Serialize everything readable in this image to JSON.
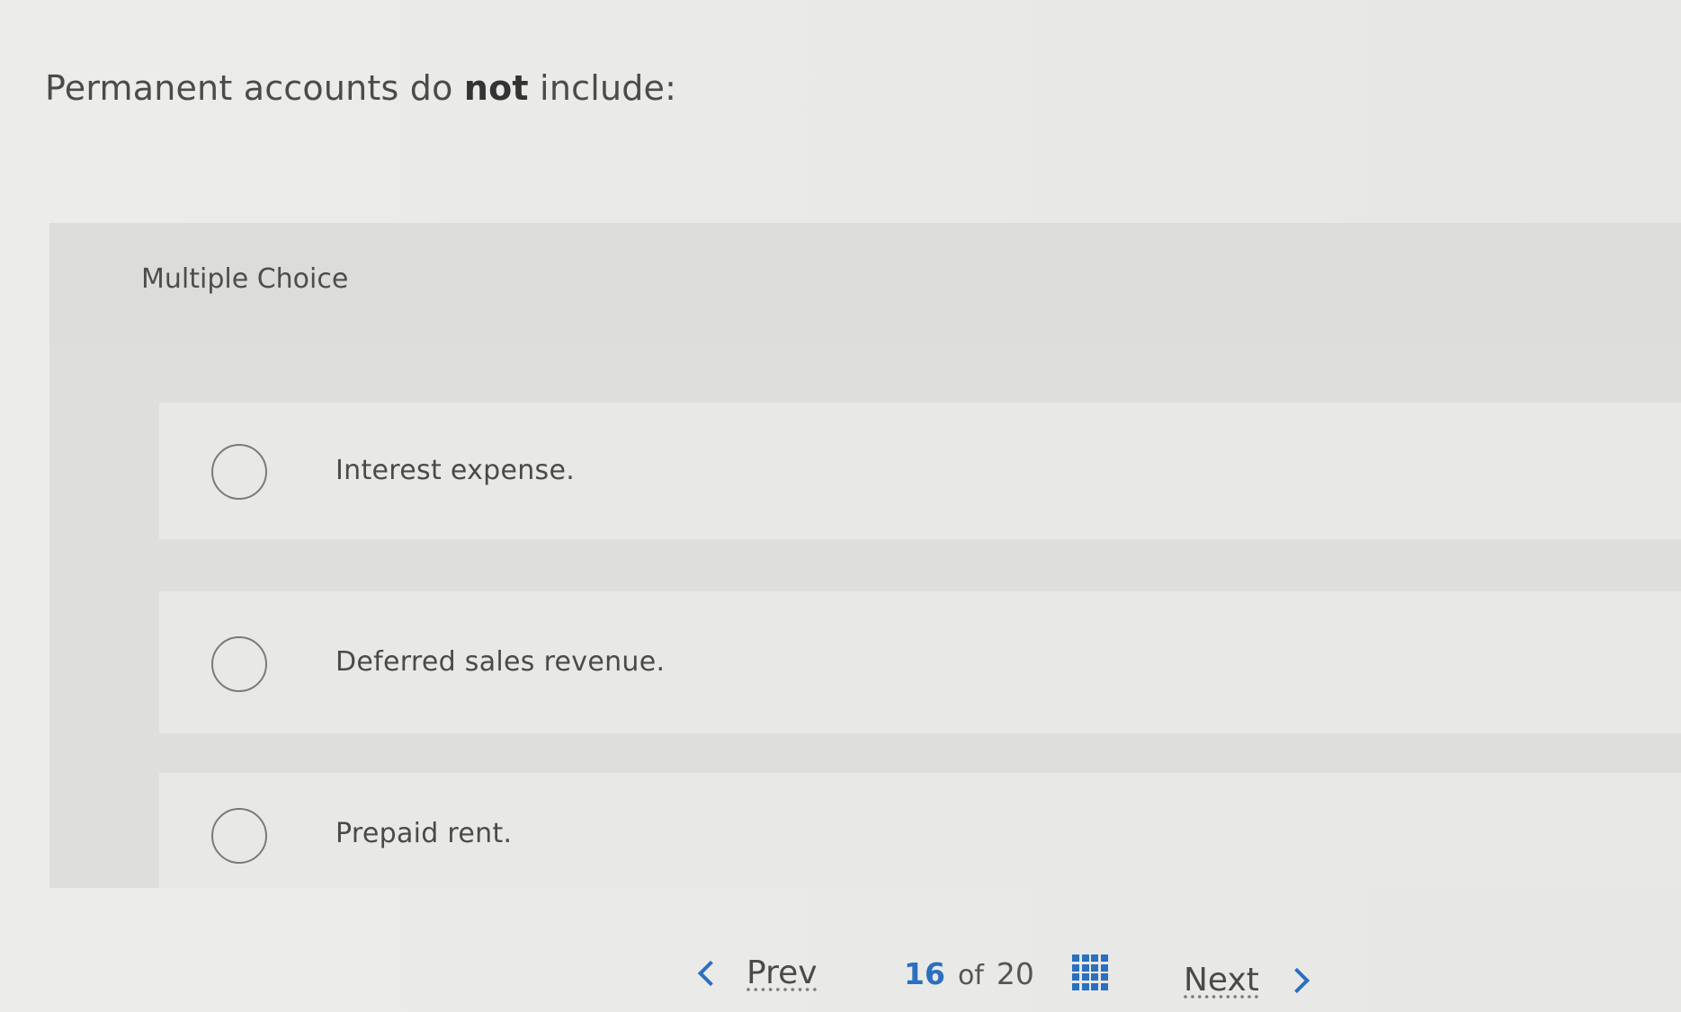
{
  "question": {
    "text_before": "Permanent accounts do ",
    "text_bold": "not",
    "text_after": " include:"
  },
  "multiple_choice": {
    "label": "Multiple Choice",
    "options": [
      {
        "label": "Interest expense.",
        "selected": false
      },
      {
        "label": "Deferred sales revenue.",
        "selected": false
      },
      {
        "label": "Prepaid rent.",
        "selected": false
      }
    ]
  },
  "navigation": {
    "prev_label": "Prev",
    "next_label": "Next",
    "current_page": "16",
    "of_label": "of",
    "total_pages": "20",
    "accent_color": "#2b6fbf",
    "prev_icon": "chevron-left-icon",
    "next_icon": "chevron-right-icon",
    "overview_icon": "grid-icon"
  }
}
